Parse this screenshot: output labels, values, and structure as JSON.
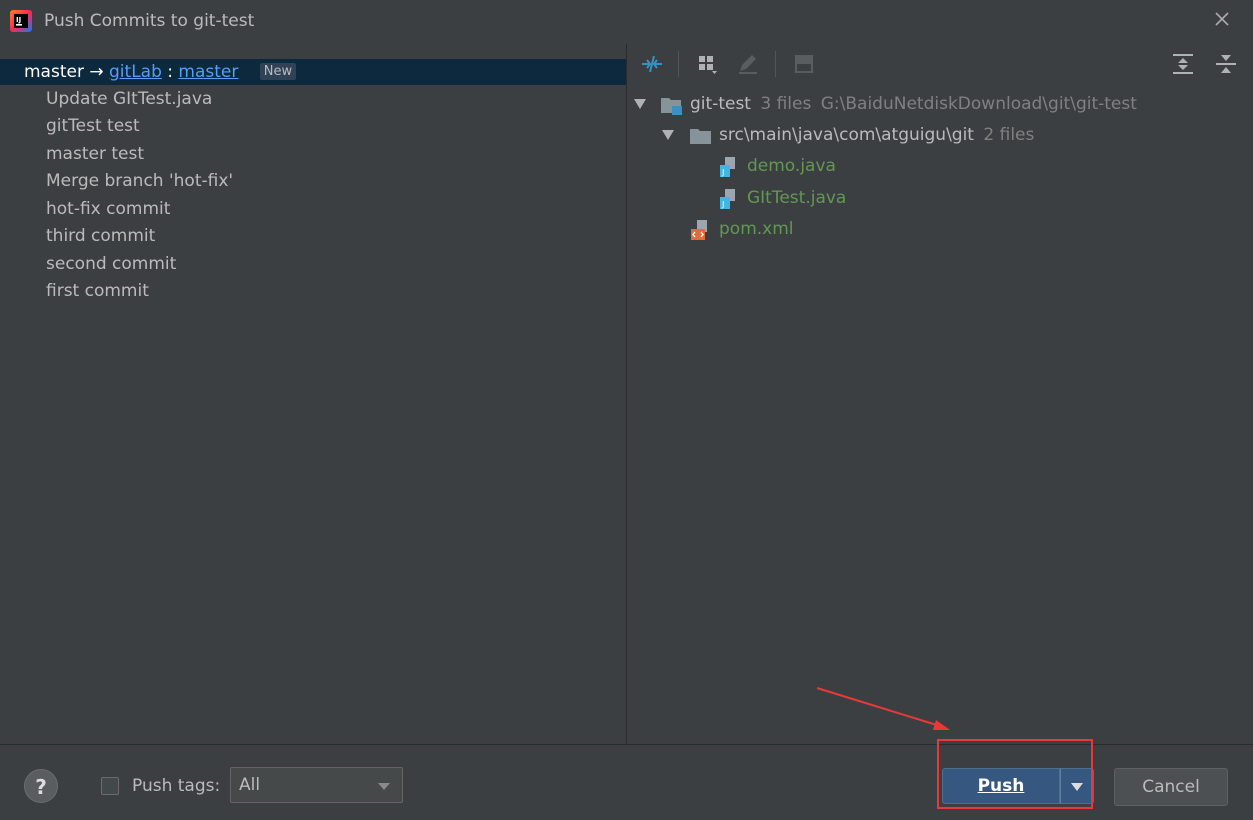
{
  "window": {
    "title": "Push Commits to git-test"
  },
  "branch": {
    "local": "master",
    "arrow": "→",
    "remote": "gitLab",
    "separator": ":",
    "remote_branch": "master",
    "badge": "New"
  },
  "commits": [
    "Update GItTest.java",
    "gitTest test",
    "master test",
    "Merge branch 'hot-fix'",
    "hot-fix commit",
    "third commit",
    "second commit",
    "first commit"
  ],
  "tree": {
    "root": {
      "name": "git-test",
      "count": "3 files",
      "path": "G:\\BaiduNetdiskDownload\\git\\git-test"
    },
    "folder": {
      "name": "src\\main\\java\\com\\atguigu\\git",
      "count": "2 files"
    },
    "files": [
      "demo.java",
      "GItTest.java"
    ],
    "root_file": "pom.xml"
  },
  "footer": {
    "help": "?",
    "push_tags_label": "Push tags:",
    "tags_select_value": "All",
    "push_label": "Push",
    "cancel_label": "Cancel"
  },
  "colors": {
    "accent": "#365880",
    "selection": "#0d293e",
    "link": "#589df6",
    "added_file": "#629755",
    "annotation": "#e8393a"
  }
}
